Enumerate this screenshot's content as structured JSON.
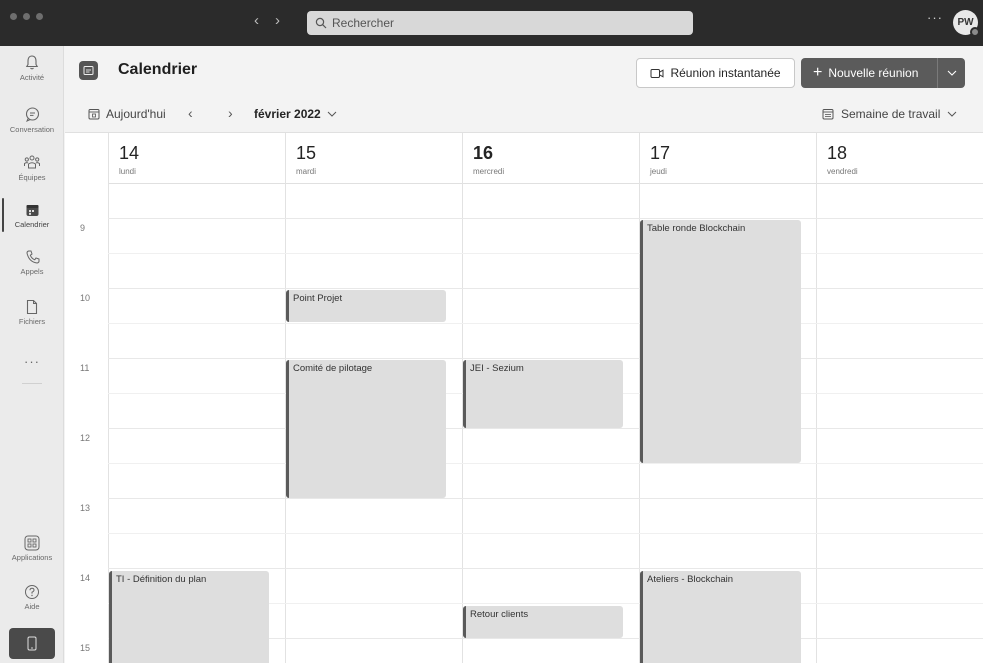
{
  "titlebar": {
    "search_placeholder": "Rechercher",
    "more_label": "···",
    "avatar_initials": "PW"
  },
  "rail": {
    "items": [
      {
        "label": "Activité",
        "icon": "bell-icon"
      },
      {
        "label": "Conversation",
        "icon": "chat-icon"
      },
      {
        "label": "Équipes",
        "icon": "teams-icon"
      },
      {
        "label": "Calendrier",
        "icon": "calendar-icon"
      },
      {
        "label": "Appels",
        "icon": "phone-icon"
      },
      {
        "label": "Fichiers",
        "icon": "file-icon"
      }
    ],
    "more_label": "···",
    "apps_label": "Applications",
    "help_label": "Aide"
  },
  "header": {
    "title": "Calendrier",
    "instant_meeting_label": "Réunion instantanée",
    "new_meeting_label": "Nouvelle réunion"
  },
  "toolbar": {
    "today_label": "Aujourd'hui",
    "month_label": "février 2022",
    "view_label": "Semaine de travail"
  },
  "days": [
    {
      "num": "14",
      "name": "lundi"
    },
    {
      "num": "15",
      "name": "mardi"
    },
    {
      "num": "16",
      "name": "mercredi"
    },
    {
      "num": "17",
      "name": "jeudi"
    },
    {
      "num": "18",
      "name": "vendredi"
    }
  ],
  "hours": [
    "9",
    "10",
    "11",
    "12",
    "13",
    "14",
    "15"
  ],
  "events": [
    {
      "title": "Table ronde Blockchain",
      "day": "17"
    },
    {
      "title": "Point Projet",
      "day": "15"
    },
    {
      "title": "Comité de pilotage",
      "day": "15"
    },
    {
      "title": "JEI - Sezium",
      "day": "16"
    },
    {
      "title": "TI - Définition du plan",
      "day": "14"
    },
    {
      "title": "Ateliers - Blockchain",
      "day": "17"
    },
    {
      "title": "Retour clients",
      "day": "16"
    }
  ],
  "colors": {
    "titlebar": "#2b2b2b",
    "accent": "#5b5b5b",
    "event_fill": "#dedede",
    "event_border": "#5a5a5a"
  }
}
